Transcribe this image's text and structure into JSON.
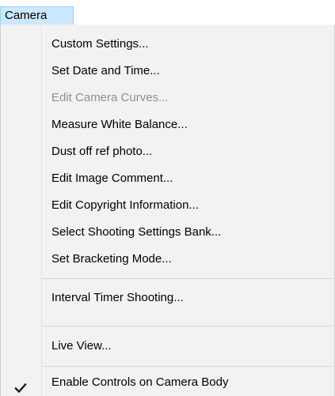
{
  "menubar": {
    "title": "Camera"
  },
  "menu": {
    "items": [
      {
        "label": "Custom Settings...",
        "enabled": true,
        "checked": false
      },
      {
        "label": "Set Date and Time...",
        "enabled": true,
        "checked": false
      },
      {
        "label": "Edit Camera Curves...",
        "enabled": false,
        "checked": false
      },
      {
        "label": "Measure White Balance...",
        "enabled": true,
        "checked": false
      },
      {
        "label": "Dust off ref photo...",
        "enabled": true,
        "checked": false
      },
      {
        "label": "Edit Image Comment...",
        "enabled": true,
        "checked": false
      },
      {
        "label": "Edit Copyright Information...",
        "enabled": true,
        "checked": false
      },
      {
        "label": "Select Shooting Settings Bank...",
        "enabled": true,
        "checked": false
      },
      {
        "label": "Set Bracketing Mode...",
        "enabled": true,
        "checked": false
      },
      {
        "label": "Interval Timer Shooting...",
        "enabled": true,
        "checked": false
      },
      {
        "label": "Live View...",
        "enabled": true,
        "checked": false
      },
      {
        "label": "Enable Controls on Camera Body",
        "enabled": true,
        "checked": true
      }
    ]
  },
  "icons": {
    "check": "checkmark-icon"
  },
  "colors": {
    "menubar_highlight": "#cce8ff",
    "menu_background": "#f2f2f2",
    "disabled_text": "#8f8f8f"
  }
}
